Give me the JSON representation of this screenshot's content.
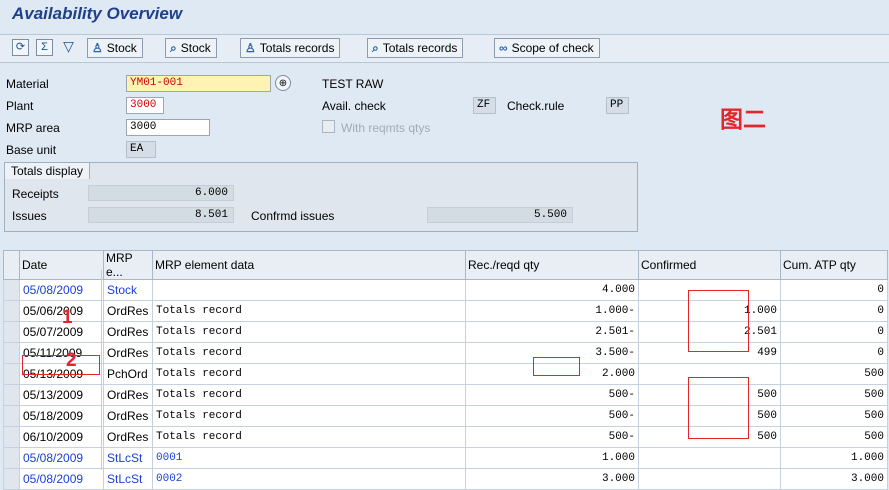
{
  "title": "Availability Overview",
  "toolbar": {
    "buttons": [
      {
        "label": "Stock"
      },
      {
        "label": "Stock"
      },
      {
        "label": "Totals records"
      },
      {
        "label": "Totals records"
      },
      {
        "label": "Scope of check"
      }
    ]
  },
  "header": {
    "material_label": "Material",
    "material_value": "YM01-001",
    "material_desc": "TEST RAW",
    "plant_label": "Plant",
    "plant_value": "3000",
    "mrp_area_label": "MRP area",
    "mrp_area_value": "3000",
    "base_unit_label": "Base unit",
    "base_unit_value": "EA",
    "avail_check_label": "Avail. check",
    "avail_check_value": "ZF",
    "check_rule_label": "Check.rule",
    "check_rule_value": "PP",
    "with_reqmts_label": "With reqmts qtys",
    "figure_label": "图二"
  },
  "totals": {
    "tab_label": "Totals display",
    "receipts_label": "Receipts",
    "receipts_value": "6.000",
    "issues_label": "Issues",
    "issues_value": "8.501",
    "confirmed_issues_label": "Confrmd issues",
    "confirmed_issues_value": "5.500"
  },
  "grid": {
    "columns": [
      "Date",
      "MRP e...",
      "MRP element data",
      "Rec./reqd qty",
      "Confirmed",
      "Cum. ATP qty"
    ],
    "rows": [
      {
        "date": "05/08/2009",
        "mrp": "Stock",
        "data": "",
        "qty": "4.000",
        "confirmed": "",
        "cum": "0",
        "blue": true
      },
      {
        "date": "05/06/2009",
        "mrp": "OrdRes",
        "data": "Totals record",
        "qty": "1.000-",
        "confirmed": "1.000",
        "cum": "0",
        "blue": false
      },
      {
        "date": "05/07/2009",
        "mrp": "OrdRes",
        "data": "Totals record",
        "qty": "2.501-",
        "confirmed": "2.501",
        "cum": "0",
        "blue": false
      },
      {
        "date": "05/11/2009",
        "mrp": "OrdRes",
        "data": "Totals record",
        "qty": "3.500-",
        "confirmed": "499",
        "cum": "0",
        "blue": false
      },
      {
        "date": "05/13/2009",
        "mrp": "PchOrd",
        "data": "Totals record",
        "qty": "2.000",
        "confirmed": "",
        "cum": "500",
        "blue": false
      },
      {
        "date": "05/13/2009",
        "mrp": "OrdRes",
        "data": "Totals record",
        "qty": "500-",
        "confirmed": "500",
        "cum": "500",
        "blue": false
      },
      {
        "date": "05/18/2009",
        "mrp": "OrdRes",
        "data": "Totals record",
        "qty": "500-",
        "confirmed": "500",
        "cum": "500",
        "blue": false
      },
      {
        "date": "06/10/2009",
        "mrp": "OrdRes",
        "data": "Totals record",
        "qty": "500-",
        "confirmed": "500",
        "cum": "500",
        "blue": false
      },
      {
        "date": "05/08/2009",
        "mrp": "StLcSt",
        "data": "0001",
        "qty": "1.000",
        "confirmed": "",
        "cum": "1.000",
        "blue": true
      },
      {
        "date": "05/08/2009",
        "mrp": "StLcSt",
        "data": "0002",
        "qty": "3.000",
        "confirmed": "",
        "cum": "3.000",
        "blue": true
      }
    ]
  },
  "annotations": {
    "marker_1": "1",
    "marker_2": "2"
  },
  "colors": {
    "title": "#1f3f8a",
    "link_blue": "#1a3fd6",
    "annotation_red": "#e3262c",
    "required_yellow": "#fff3b3"
  },
  "icons": [
    "refresh-icon",
    "totals-sigma-icon",
    "filter-icon",
    "person-stock-icon",
    "magnifier-stock-icon",
    "person-totals-icon",
    "magnifier-totals-icon",
    "scope-glasses-icon",
    "input-help-icon",
    "checkbox-icon"
  ]
}
